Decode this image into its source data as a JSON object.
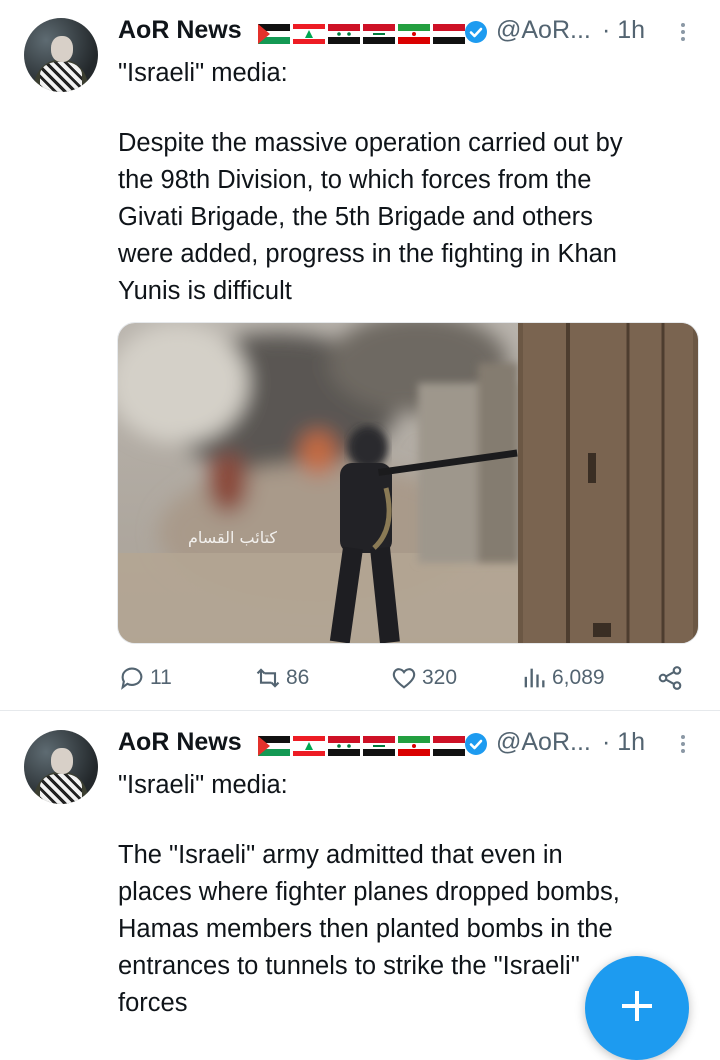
{
  "tweets": [
    {
      "author_name": "AoR News",
      "handle": "@AoR...",
      "time": "· 1h",
      "text_line1": "\"Israeli\" media:",
      "text_body": "Despite the massive operation carried out by\nthe 98th Division, to which forces from the\nGivati Brigade, the 5th Brigade and others\nwere added, progress in the fighting in Khan\nYunis is difficult",
      "media": {
        "watermark_text": "كتائب القسام"
      },
      "stats": {
        "replies": "11",
        "retweets": "86",
        "likes": "320",
        "views": "6,089"
      }
    },
    {
      "author_name": "AoR News",
      "handle": "@AoR...",
      "time": "· 1h",
      "text_line1": "\"Israeli\" media:",
      "text_body": "The \"Israeli\" army admitted that even in\nplaces where fighter planes dropped bombs,\nHamas members then planted bombs in the\nentrances to tunnels to strike the \"Israeli\"\nforces"
    }
  ],
  "icons": {
    "reply": "reply-icon",
    "retweet": "retweet-icon",
    "like": "heart-icon",
    "views": "bar-chart-icon",
    "share": "share-icon",
    "compose": "plus-icon"
  },
  "colors": {
    "accent": "#1d9bf0",
    "secondary_text": "#536471",
    "primary_text": "#0f1419"
  }
}
